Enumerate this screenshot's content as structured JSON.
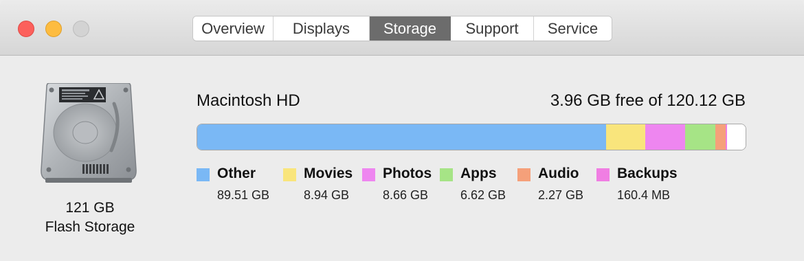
{
  "window": {
    "buttons": {
      "close": "close",
      "minimize": "minimize",
      "zoom": "zoom"
    },
    "tabs": [
      {
        "label": "Overview",
        "active": false
      },
      {
        "label": "Displays",
        "active": false
      },
      {
        "label": "Storage",
        "active": true
      },
      {
        "label": "Support",
        "active": false
      },
      {
        "label": "Service",
        "active": false
      }
    ]
  },
  "drive": {
    "icon": "hard-drive-icon",
    "capacity": "121 GB",
    "type": "Flash Storage"
  },
  "volume": {
    "name": "Macintosh HD",
    "free_text": "3.96 GB free of 120.12 GB",
    "free_fraction": 0.033,
    "categories": [
      {
        "label": "Other",
        "value": "89.51 GB",
        "color": "#7ab8f5",
        "fraction": 0.745
      },
      {
        "label": "Movies",
        "value": "8.94 GB",
        "color": "#f9e57c",
        "fraction": 0.0725
      },
      {
        "label": "Photos",
        "value": "8.66 GB",
        "color": "#ee86f0",
        "fraction": 0.0725
      },
      {
        "label": "Apps",
        "value": "6.62 GB",
        "color": "#a6e486",
        "fraction": 0.055
      },
      {
        "label": "Audio",
        "value": "2.27 GB",
        "color": "#f5a07a",
        "fraction": 0.019
      },
      {
        "label": "Backups",
        "value": "160.4 MB",
        "color": "#f07ee3",
        "fraction": 0.002
      }
    ],
    "free_color": "#ffffff"
  }
}
